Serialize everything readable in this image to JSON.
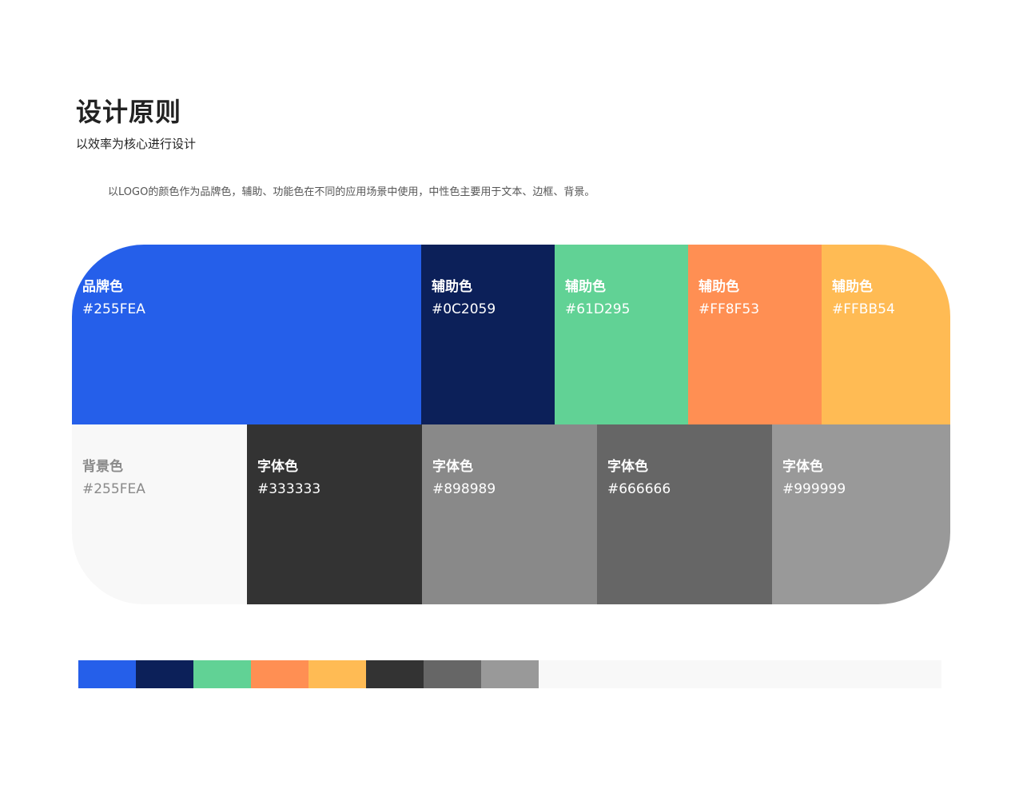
{
  "header": {
    "title": "设计原则",
    "subtitle": "以效率为核心进行设计",
    "description": "以LOGO的颜色作为品牌色，辅助、功能色在不同的应用场景中使用，中性色主要用于文本、边框、背景。"
  },
  "palette": {
    "top": [
      {
        "name": "品牌色",
        "hex": "#255FEA",
        "color": "#255FEA",
        "span": 437
      },
      {
        "name": "辅助色",
        "hex": "#0C2059",
        "color": "#0C2059",
        "span": 167
      },
      {
        "name": "辅助色",
        "hex": "#61D295",
        "color": "#61D295",
        "span": 167
      },
      {
        "name": "辅助色",
        "hex": "#FF8F53",
        "color": "#FF8F53",
        "span": 167
      },
      {
        "name": "辅助色",
        "hex": "#FFBB54",
        "color": "#FFBB54",
        "span": 161
      }
    ],
    "bottom": [
      {
        "name": "背景色",
        "hex": "#255FEA",
        "color": "#F8F8F8",
        "span": 219,
        "light": true
      },
      {
        "name": "字体色",
        "hex": "#333333",
        "color": "#333333",
        "span": 219
      },
      {
        "name": "字体色",
        "hex": "#898989",
        "color": "#898989",
        "span": 219
      },
      {
        "name": "字体色",
        "hex": "#666666",
        "color": "#666666",
        "span": 219
      },
      {
        "name": "字体色",
        "hex": "#999999",
        "color": "#999999",
        "span": 223
      }
    ]
  },
  "strip": {
    "background": "#F8F8F8",
    "swatches": [
      "#255FEA",
      "#0C2059",
      "#61D295",
      "#FF8F53",
      "#FFBB54",
      "#333333",
      "#666666",
      "#999999"
    ]
  }
}
